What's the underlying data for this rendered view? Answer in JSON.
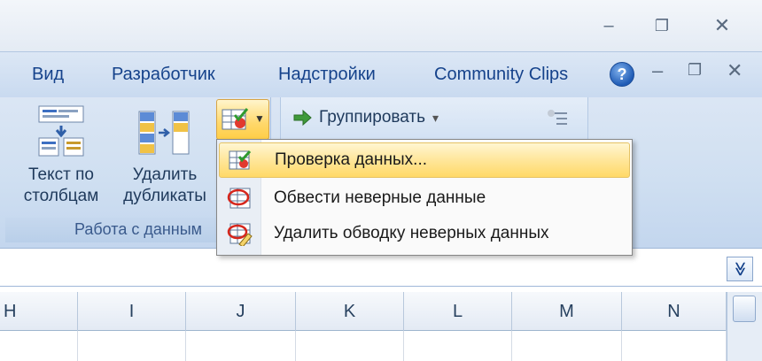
{
  "window": {
    "minimize_glyph": "–",
    "restore_glyph": "❐",
    "close_glyph": "✕"
  },
  "tabs": [
    {
      "label": "Вид"
    },
    {
      "label": "Разработчик"
    },
    {
      "label": "Надстройки"
    },
    {
      "label": "Community Clips"
    }
  ],
  "help_glyph": "?",
  "ribbon": {
    "text_to_columns_line1": "Текст по",
    "text_to_columns_line2": "столбцам",
    "remove_duplicates_line1": "Удалить",
    "remove_duplicates_line2": "дубликаты",
    "group_label": "Работа с данным",
    "group_button": "Группировать",
    "group_button_arrow": "▾"
  },
  "menu": {
    "items": [
      {
        "label": "Проверка данных...",
        "icon": "data-validation-icon",
        "highlighted": true
      },
      {
        "label": "Обвести неверные данные",
        "icon": "circle-invalid-icon",
        "highlighted": false
      },
      {
        "label": "Удалить обводку неверных данных",
        "icon": "clear-circles-icon",
        "highlighted": false
      }
    ]
  },
  "formula_bar": {
    "expand_glyph": "≫"
  },
  "columns": [
    "H",
    "I",
    "J",
    "K",
    "L",
    "M",
    "N"
  ],
  "colors": {
    "highlight": "#ffe69a",
    "ribbon": "#cfdff1",
    "tab_text": "#15428b"
  }
}
